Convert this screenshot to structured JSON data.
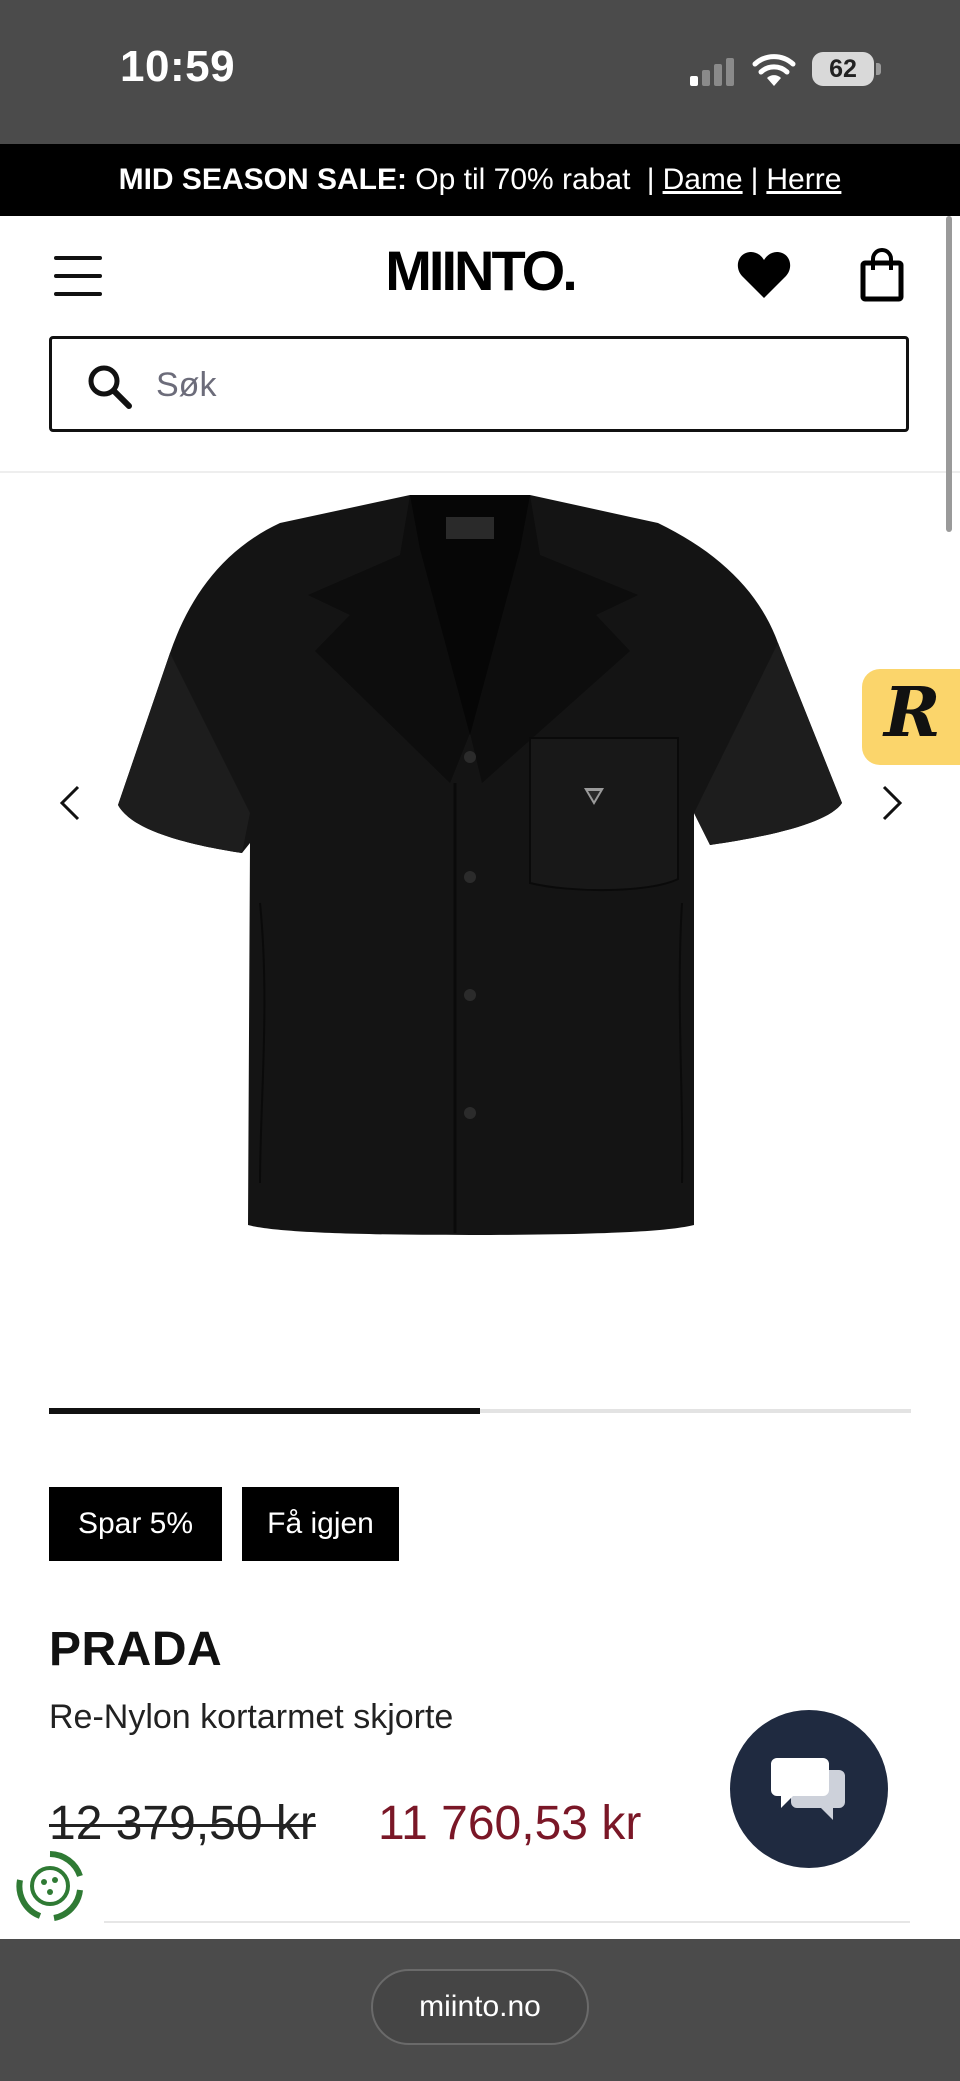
{
  "status_bar": {
    "time": "10:59",
    "battery": "62"
  },
  "promo": {
    "bold": "MID SEASON SALE:",
    "text": "Op til 70% rabat",
    "link_women": "Dame",
    "link_men": "Herre",
    "separator": "|"
  },
  "header": {
    "logo": "MIINTO.",
    "icons": [
      "menu-icon",
      "heart-icon",
      "shopping-bag-icon"
    ]
  },
  "search": {
    "placeholder": "Søk",
    "value": ""
  },
  "gallery": {
    "image": "black short-sleeve nylon shirt",
    "active_slide_fraction": 0.5,
    "floating_badge": "R"
  },
  "badges": {
    "save": "Spar 5%",
    "back_in_stock": "Få igjen"
  },
  "product": {
    "brand": "PRADA",
    "name": "Re-Nylon kortarmet skjorte",
    "price_old": "12 379,50 kr",
    "price_new": "11 760,53 kr"
  },
  "browser": {
    "url": "miinto.no"
  },
  "colors": {
    "sale_price": "#7a1727",
    "chat_button": "#1f2a40",
    "badge_yellow": "#fbd56b"
  }
}
